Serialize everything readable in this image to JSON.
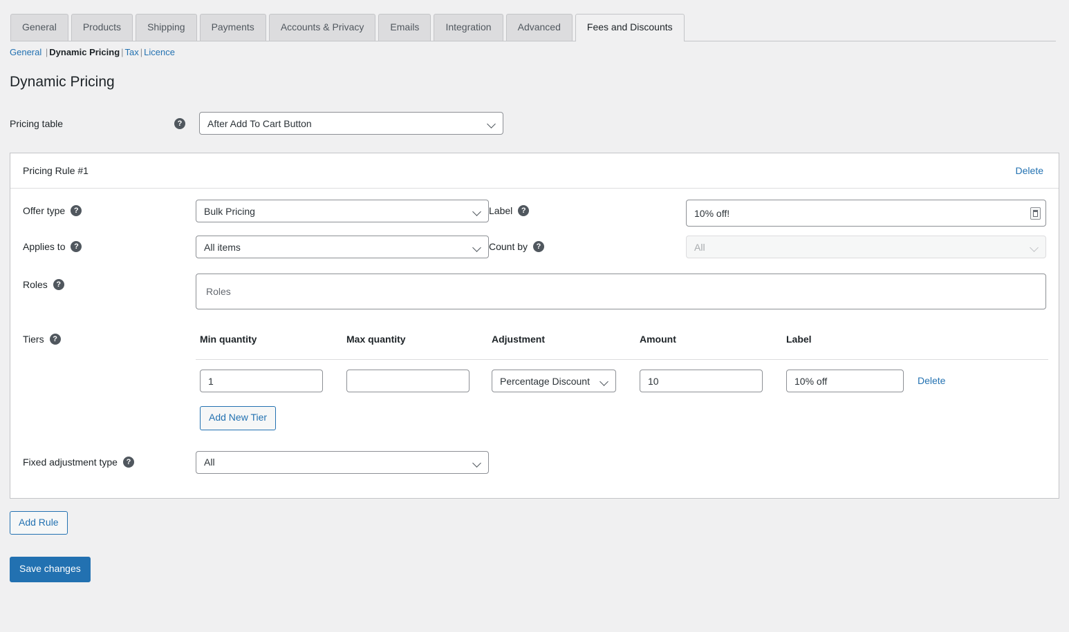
{
  "tabs": [
    {
      "label": "General",
      "active": false
    },
    {
      "label": "Products",
      "active": false
    },
    {
      "label": "Shipping",
      "active": false
    },
    {
      "label": "Payments",
      "active": false
    },
    {
      "label": "Accounts & Privacy",
      "active": false
    },
    {
      "label": "Emails",
      "active": false
    },
    {
      "label": "Integration",
      "active": false
    },
    {
      "label": "Advanced",
      "active": false
    },
    {
      "label": "Fees and Discounts",
      "active": true
    }
  ],
  "subnav": {
    "items": [
      {
        "label": "General",
        "current": false
      },
      {
        "label": "Dynamic Pricing",
        "current": true
      },
      {
        "label": "Tax",
        "current": false
      },
      {
        "label": "Licence",
        "current": false
      }
    ],
    "separator": "|"
  },
  "page_title": "Dynamic Pricing",
  "pricing_table": {
    "label": "Pricing table",
    "help_icon": "question-mark-icon",
    "value": "After Add To Cart Button"
  },
  "rule": {
    "title": "Pricing Rule #1",
    "delete_label": "Delete",
    "offer_type": {
      "label": "Offer type",
      "value": "Bulk Pricing"
    },
    "rule_label": {
      "label": "Label",
      "value": "10% off!",
      "trailing_icon": "wpml-translate-icon"
    },
    "applies_to": {
      "label": "Applies to",
      "value": "All items"
    },
    "count_by": {
      "label": "Count by",
      "value": "All",
      "disabled": true
    },
    "roles": {
      "label": "Roles",
      "placeholder": "Roles",
      "value": ""
    },
    "tiers": {
      "label": "Tiers",
      "columns": [
        "Min quantity",
        "Max quantity",
        "Adjustment",
        "Amount",
        "Label",
        ""
      ],
      "rows": [
        {
          "min_quantity": "1",
          "max_quantity": "",
          "adjustment": "Percentage Discount",
          "amount": "10",
          "label": "10% off",
          "delete_label": "Delete"
        }
      ],
      "add_tier_label": "Add New Tier"
    },
    "fixed_adjustment_type": {
      "label": "Fixed adjustment type",
      "value": "All"
    }
  },
  "actions": {
    "add_rule_label": "Add Rule",
    "save_label": "Save changes"
  },
  "colors": {
    "accent": "#2271b1",
    "page_bg": "#f0f0f1",
    "tab_inactive_bg": "#dcdcde",
    "border": "#c3c4c7",
    "text": "#1d2327"
  }
}
